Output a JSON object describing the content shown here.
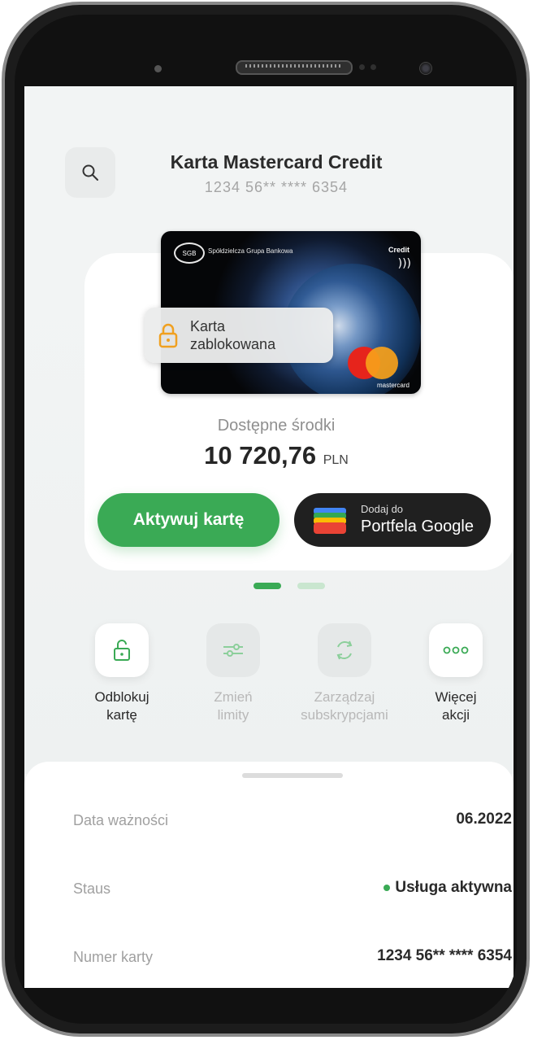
{
  "header": {
    "title": "Karta Mastercard Credit",
    "card_number_masked": "1234 56** **** 6354"
  },
  "card": {
    "bank_name": "Spółdzielcza Grupa Bankowa",
    "logo_text": "SGB",
    "type_label": "Credit",
    "network_label": "mastercard",
    "blocked_status": "Karta zablokowana"
  },
  "balance": {
    "label": "Dostępne środki",
    "amount": "10 720,76",
    "currency": "PLN"
  },
  "buttons": {
    "activate": "Aktywuj kartę",
    "gpay_line1": "Dodaj do",
    "gpay_line2": "Portfela Google"
  },
  "pager": {
    "pages": 2,
    "active": 1
  },
  "actions": [
    {
      "label1": "Odblokuj",
      "label2": "kartę",
      "enabled": true
    },
    {
      "label1": "Zmień",
      "label2": "limity",
      "enabled": false
    },
    {
      "label1": "Zarządzaj",
      "label2": "subskrypcjami",
      "enabled": false
    },
    {
      "label1": "Więcej",
      "label2": "akcji",
      "enabled": true
    }
  ],
  "details": {
    "expiry_label": "Data ważności",
    "expiry_value": "06.2022",
    "status_label": "Staus",
    "status_value": "Usługa aktywna",
    "number_label": "Numer karty",
    "number_value": "1234 56** **** 6354"
  },
  "colors": {
    "accent_green": "#3aaa55",
    "screen_bg": "#f2f4f4",
    "dark_button": "#202020"
  }
}
